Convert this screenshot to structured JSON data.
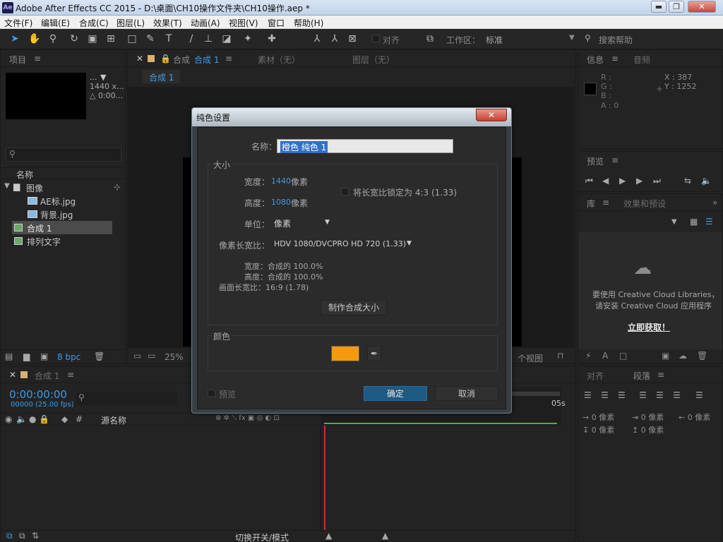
{
  "window": {
    "title": "Adobe After Effects CC 2015 - D:\\桌面\\CH10操作文件夹\\CH10操作.aep *",
    "logo": "Ae",
    "min": "▬",
    "max": "❐",
    "close": "✕"
  },
  "menu": [
    "文件(F)",
    "编辑(E)",
    "合成(C)",
    "图层(L)",
    "效果(T)",
    "动画(A)",
    "视图(V)",
    "窗口",
    "帮助(H)"
  ],
  "toolbar": {
    "snap_label": "对齐",
    "workspace_label": "工作区：",
    "workspace_value": "标准",
    "search_placeholder": "搜索帮助"
  },
  "project_panel": {
    "tab": "项目",
    "thumb_info_1": "...",
    "thumb_info_2": "1440 x...",
    "thumb_info_3": "△ 0:00...",
    "col_name": "名称",
    "items": [
      {
        "label": "图像",
        "type": "folder"
      },
      {
        "label": "AE标.jpg",
        "type": "image"
      },
      {
        "label": "背景.jpg",
        "type": "image"
      },
      {
        "label": "合成 1",
        "type": "comp",
        "selected": true
      },
      {
        "label": "排列文字",
        "type": "comp"
      }
    ],
    "bpc": "8 bpc"
  },
  "comp_panel": {
    "tab": "合成 合成 1",
    "tab_name": "合成 1",
    "footage_tab": "素材（无）",
    "layer_tab": "图层（无）",
    "comp_label": "合成 1",
    "zoom": "25%",
    "view": "个视图"
  },
  "info_panel": {
    "tab": "信息",
    "audio_tab": "音频",
    "r": "R :",
    "g": "G :",
    "b": "B :",
    "a": "A : 0",
    "x": "X : 387",
    "y": "Y : 1252"
  },
  "preview_panel": {
    "tab": "预览"
  },
  "library_panel": {
    "tab": "库",
    "effects_tab": "效果和预设",
    "msg1": "要使用 Creative Cloud Libraries，",
    "msg2": "请安装 Creative Cloud 应用程序",
    "link": "立即获取！"
  },
  "align_panel": {
    "tab": "对齐",
    "para_tab": "段落",
    "px": "0 像素"
  },
  "timeline": {
    "tab": "合成 1",
    "timecode": "0:00:00:00",
    "fps": "00000 (25.00 fps)",
    "src_name": "源名称",
    "time_05": "05s",
    "switch_mode": "切换开关/模式"
  },
  "dialog": {
    "title": "纯色设置",
    "close": "✕",
    "name_label": "名称：",
    "name_value": "橙色 纯色 1",
    "size_group": "大小",
    "width_label": "宽度：",
    "width_value": "1440",
    "width_unit": "像素",
    "height_label": "高度：",
    "height_value": "1080",
    "height_unit": "像素",
    "lock_ratio": "将长宽比锁定为 4:3 (1.33)",
    "unit_label": "单位：",
    "unit_value": "像素",
    "par_label": "像素长宽比：",
    "par_value": "HDV 1080/DVCPRO HD 720 (1.33)",
    "info_width": "宽度：合成的 100.0%",
    "info_height": "高度：合成的 100.0%",
    "info_frame": "画面长宽比：16:9 (1.78)",
    "make_comp_size": "制作合成大小",
    "color_group": "颜色",
    "color_value": "#f39a11",
    "preview": "预览",
    "ok": "确定",
    "cancel": "取消"
  }
}
